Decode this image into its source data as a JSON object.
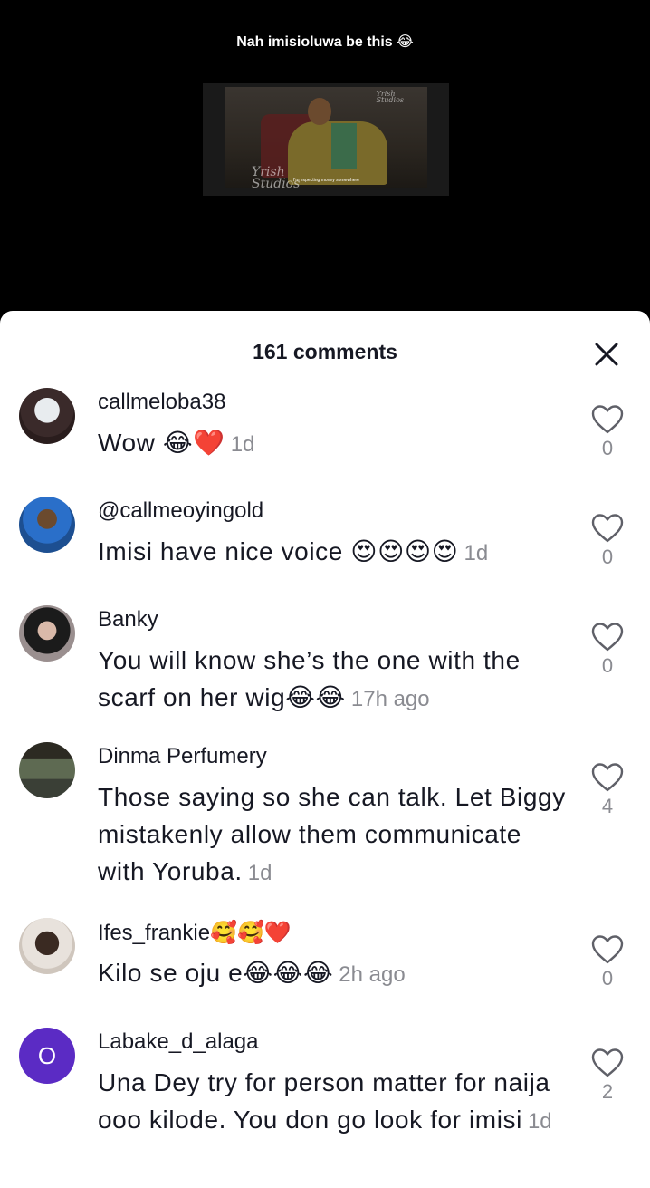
{
  "video": {
    "caption": "Nah imisioluwa be this 😂",
    "watermark_left_1": "Yrish",
    "watermark_left_2": "Studios",
    "watermark_right_1": "Yrish",
    "watermark_right_2": "Studios",
    "subtitle": "I'm expecting money somewhere"
  },
  "sheet": {
    "title": "161 comments"
  },
  "comments": [
    {
      "username": "callmeloba38",
      "text": "Wow 😂❤️",
      "time": "1d",
      "likes": "0"
    },
    {
      "username": "@callmeoyingold",
      "text": "Imisi have nice voice 😍😍😍😍",
      "time": "1d",
      "likes": "0"
    },
    {
      "username": "Banky",
      "text": "You will know she’s the one with the scarf on her wig😂😂",
      "time": "17h ago",
      "likes": "0"
    },
    {
      "username": "Dinma Perfumery",
      "text": "Those saying so she can talk. Let Biggy mistakenly allow them communicate with Yoruba.",
      "time": "1d",
      "likes": "4"
    },
    {
      "username": "Ifes_frankie🥰🥰❤️",
      "text": "Kilo se oju e😂😂😂",
      "time": "2h ago",
      "likes": "0"
    },
    {
      "username": "Labake_d_alaga",
      "text": "Una Dey try for person matter for naija ooo kilode. You don go look for imisi",
      "time": "1d",
      "likes": "2",
      "avatar_letter": "O"
    }
  ],
  "colors": {
    "text": "#161823",
    "muted": "#8a8b91",
    "avatar_purple": "#5b2bc4"
  }
}
